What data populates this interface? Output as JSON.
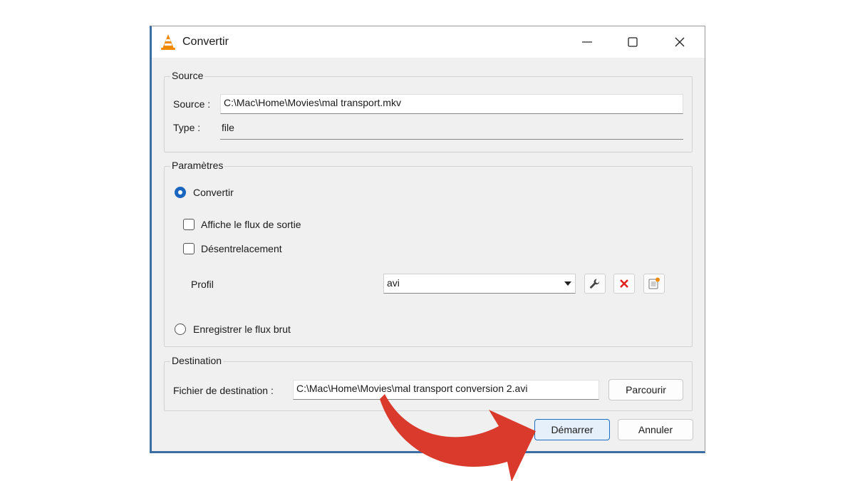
{
  "window": {
    "title": "Convertir",
    "icon": "vlc-cone-icon"
  },
  "source_group": {
    "title": "Source",
    "source_label": "Source :",
    "source_value": "C:\\Mac\\Home\\Movies\\mal transport.mkv",
    "type_label": "Type :",
    "type_value": "file"
  },
  "params_group": {
    "title": "Paramètres",
    "convert_label": "Convertir",
    "convert_selected": true,
    "show_output_label": "Affiche le flux de sortie",
    "show_output_checked": false,
    "deinterlace_label": "Désentrelacement",
    "deinterlace_checked": false,
    "profile_label": "Profil",
    "profile_value": "avi",
    "raw_label": "Enregistrer le flux brut",
    "raw_selected": false
  },
  "dest_group": {
    "title": "Destination",
    "dest_label": "Fichier de destination :",
    "dest_value": "C:\\Mac\\Home\\Movies\\mal transport conversion 2.avi",
    "browse_label": "Parcourir"
  },
  "buttons": {
    "start_label": "Démarrer",
    "cancel_label": "Annuler"
  },
  "colors": {
    "accent": "#1965c0",
    "arrow": "#d93a2b",
    "delete": "#e02020"
  }
}
